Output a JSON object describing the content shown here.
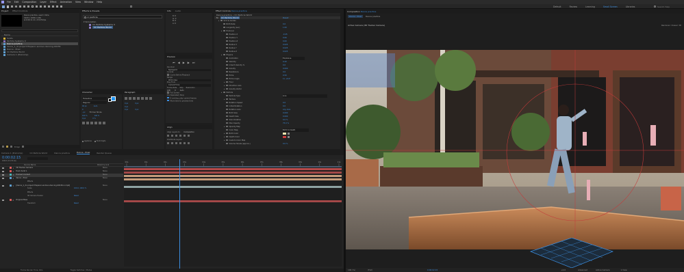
{
  "menu": {
    "items": [
      "File",
      "Edit",
      "Composition",
      "Layer",
      "Effect",
      "Animation",
      "View",
      "Window",
      "Help"
    ]
  },
  "toolbar": {
    "default_label": "Default",
    "review_label": "Review",
    "learning_label": "Learning",
    "small_screen_label": "Small Screen",
    "libraries_label": "Libraries",
    "standard_label": "Standard",
    "search_help_placeholder": "Search Help"
  },
  "project": {
    "tab_label": "Project",
    "effect_controls_tab": "Effect Controls",
    "selected_name": "Dance practice",
    "info_lines": [
      "Dance practice, used 1 time",
      "1920 x 1080 (1.00)",
      "Δ 0:00:11:11, 23.976 fps"
    ],
    "search_placeholder": "",
    "col_name": "Name",
    "items": [
      {
        "name": "Solids",
        "color": "#d4b13c"
      },
      {
        "name": "Particle Systems II",
        "color": "#8a6fb5"
      },
      {
        "name": "Dance practice",
        "color": "#5f9ecf"
      },
      {
        "name": "dance_1_dc.project.Hispanic-women-dancing-00156",
        "color": "#5f9ecf"
      },
      {
        "name": "Dance - Pixel",
        "color": "#5f9ecf"
      },
      {
        "name": "CC Particle World",
        "color": "#5f9ecf"
      },
      {
        "name": "Camera 1 (PreComp)",
        "color": "#5f9ecf"
      }
    ],
    "bpc_label": "8 bpc"
  },
  "effects_presets": {
    "tab_label": "Effects & Presets",
    "search_value": "cc particle",
    "group_label": "Simulation",
    "items": [
      "CC Particle Systems II",
      "CC Particle World"
    ]
  },
  "info_audio": {
    "tabs": [
      "Info",
      "Audio"
    ],
    "lines": [
      "R: 0",
      "G: 0",
      "B: 0",
      "A: 0"
    ]
  },
  "preview": {
    "tab_label": "Preview",
    "shortcut_label": "Shortcut",
    "shortcut_value": "Numpad 0",
    "include_label": "Include:",
    "cache_label": "Cache Before Playback",
    "range_label": "Range",
    "range_value": "Work Area",
    "play_from_label": "Play From",
    "play_from_value": "Current Time",
    "frame_rate_label": "Frame Rate",
    "skip_label": "Skip",
    "resolution_label": "Resolution",
    "frame_rate_value": "(24)",
    "skip_value": "0",
    "resolution_value": "Auto",
    "full_screen_label": "Full Screen",
    "stop_label": "On (Spacebar) Stop:",
    "if_caching_label": "If caching, play cached frames",
    "move_time_label": "Move time to preview time"
  },
  "align": {
    "tab_label": "Align",
    "align_to_label": "Align Layers to:",
    "align_to_value": "Composition",
    "distribute_label": "Distribute Layers:"
  },
  "character": {
    "tab_label": "Character",
    "font_value": "Helvetica",
    "style_value": "Regular",
    "size_value": "40 px",
    "leading_value": "Auto",
    "tracking_value": "0",
    "stroke_value": "- px",
    "stroke_mode_value": "Fill Over Stroke",
    "vscale_value": "100 %",
    "hscale_value": "100 %",
    "baseline_value": "0 px",
    "tsume_value": "0 %",
    "ligatures_label": "Ligatures",
    "hindi_digits_label": "Hindi Digits"
  },
  "paragraph": {
    "tab_label": "Paragraph",
    "indent_values": [
      "0 px",
      "0 px",
      "0 px"
    ],
    "space_values": [
      "0 px",
      "0 px"
    ]
  },
  "effect_controls": {
    "tab_label": "Effect Controls",
    "layer_name": "Dance practice",
    "header": "Dance practice • CC Particle World",
    "effect_name": "CC Particle World",
    "reset_label": "Reset",
    "properties": [
      {
        "name": "Grid & Guides",
        "value": ""
      },
      {
        "name": "Birth Rate",
        "value": "0.0",
        "indent": 1
      },
      {
        "name": "Longevity (sec)",
        "value": "1.00",
        "indent": 1
      },
      {
        "name": "Producer",
        "value": "",
        "indent": 1
      },
      {
        "name": "Position X",
        "value": "-0.45",
        "indent": 2
      },
      {
        "name": "Position Y",
        "value": "0.06",
        "indent": 2
      },
      {
        "name": "Position Z",
        "value": "0.00",
        "indent": 2
      },
      {
        "name": "Radius X",
        "value": "0.025",
        "indent": 2
      },
      {
        "name": "Radius Y",
        "value": "0.025",
        "indent": 2
      },
      {
        "name": "Radius Z",
        "value": "0.025",
        "indent": 2
      },
      {
        "name": "Physics",
        "value": "",
        "indent": 1
      },
      {
        "name": "Animation",
        "value": "Explosive",
        "indent": 2
      },
      {
        "name": "Velocity",
        "value": "0.20",
        "indent": 2
      },
      {
        "name": "Inherit Velocity %",
        "value": "0.0",
        "indent": 2
      },
      {
        "name": "Gravity",
        "value": "0.000",
        "indent": 2
      },
      {
        "name": "Resistance",
        "value": "0.0",
        "indent": 2
      },
      {
        "name": "Extra",
        "value": "0.50",
        "indent": 2
      },
      {
        "name": "Extra Angle",
        "value": "1x +0.0°",
        "indent": 2
      },
      {
        "name": "Floor",
        "value": "",
        "indent": 2
      },
      {
        "name": "Direction Axis",
        "value": "",
        "indent": 2
      },
      {
        "name": "Gravity Vector",
        "value": "",
        "indent": 2
      },
      {
        "name": "Particle",
        "value": "",
        "indent": 1
      },
      {
        "name": "Particle Type",
        "value": "Line",
        "indent": 2
      },
      {
        "name": "Texture",
        "value": "",
        "indent": 2
      },
      {
        "name": "Rotation Speed",
        "value": "0.0",
        "indent": 2
      },
      {
        "name": "Initial Rotation",
        "value": "0.0",
        "indent": 2
      },
      {
        "name": "Rotation Axis",
        "value": "Any Axis",
        "indent": 2
      },
      {
        "name": "Birth Size",
        "value": "0.000",
        "indent": 2
      },
      {
        "name": "Death Size",
        "value": "0.000",
        "indent": 2
      },
      {
        "name": "Size Variation",
        "value": "0.0 %",
        "indent": 2
      },
      {
        "name": "Max Opacity",
        "value": "75.0 %",
        "indent": 2
      },
      {
        "name": "Opacity Map",
        "value": "",
        "indent": 2
      },
      {
        "name": "Color Map",
        "value": "Birth to Death",
        "indent": 2
      },
      {
        "name": "Birth Color",
        "value": "",
        "indent": 2
      },
      {
        "name": "Death Color",
        "value": "",
        "indent": 2
      },
      {
        "name": "Custom Color Map",
        "value": "",
        "indent": 2
      },
      {
        "name": "Volume Shade (approx.)",
        "value": "0.0 %",
        "indent": 2
      }
    ]
  },
  "composition": {
    "tab_label": "Composition",
    "comp_name": "Dance practice",
    "breadcrumbs": [
      "Dance - Pixel",
      "Dance practice"
    ],
    "view_label": "Active Camera (3D Tracker Camera)",
    "renderer_label": "Renderer: Classic 3D",
    "zoom_value": "100 (%)",
    "quality_value": "(Full)",
    "timecode": "0:00:02:15",
    "view_mode_value": "Active Camera",
    "views_value": "1 View",
    "plus_value": "+0.0",
    "advanced_label": "Advanced"
  },
  "timeline": {
    "tabs": [
      "Camera 1 (PreComp)",
      "CC Particle World",
      "Dance practice",
      "Dance - Pixel",
      "Render Queue"
    ],
    "active_tab_index": 3,
    "timecode": "0:00:02:15",
    "fps_label": "00063 (23.976 fps)",
    "col_source": "Source Name",
    "col_parent": "Parent & Link",
    "ruler_ticks": [
      "00s",
      "01s",
      "02s",
      "03s",
      "04s",
      "05s",
      "06s",
      "07s",
      "08s",
      "09s",
      "10s",
      "11s"
    ],
    "playhead": 0.255,
    "layers": [
      {
        "num": "1",
        "name": "3D Tracker Camera",
        "color": "#d95b5b",
        "bar": "#b54a4a",
        "parent": "None"
      },
      {
        "num": "2",
        "name": "Track Solid 1",
        "color": "#d95b5b",
        "bar": "#a44848",
        "parent": "None"
      },
      {
        "num": "3",
        "name": "Tracked Content",
        "color": "#48b5b5",
        "bar": "#c59a7a",
        "parent": "None"
      },
      {
        "num": "4",
        "name": "dance - Pixel",
        "color": "#5f9ecf",
        "bar": "#c59a7a",
        "parent": "None"
      },
      {
        "num": "5",
        "name": "[dance_1_dc.project.Hispanic-women-dancing-00156-1.mp4]",
        "color": "#5f9ecf",
        "bar": "#8fa3a3",
        "parent": "None"
      },
      {
        "num": "6",
        "name": "Original Base",
        "color": "#d95b5b",
        "bar": "#a44848",
        "parent": "None"
      }
    ],
    "sublabels": [
      {
        "name": "Effects",
        "value": ""
      },
      {
        "name": "Scale",
        "value": "100.0, 100.0 %"
      },
      {
        "name": "Effects",
        "value": ""
      },
      {
        "name": "3D Camera Tracker",
        "value": "Reset"
      },
      {
        "name": "Transform",
        "value": "Reset"
      }
    ],
    "status_left": "Frame Render Time: 0ms",
    "status_mid": "Toggle Switches / Modes"
  },
  "colors": {
    "accent": "#3d8fe0",
    "panel": "#232323",
    "background": "#1d1d1d"
  }
}
